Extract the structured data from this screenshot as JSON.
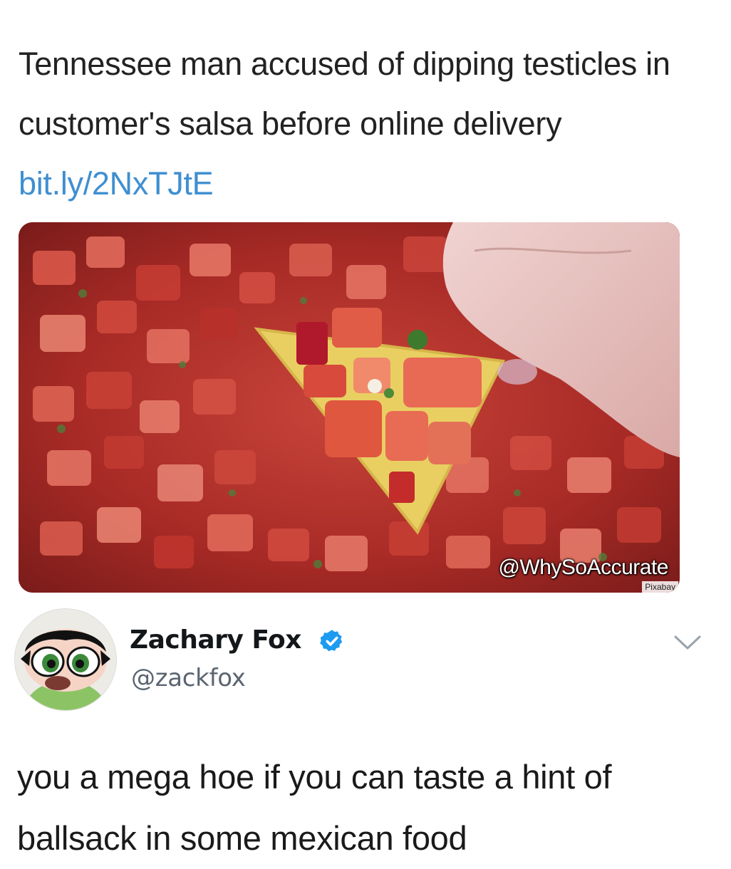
{
  "quoted_post": {
    "text": "Tennessee man accused of dipping testicles in customer's salsa before online delivery",
    "link": "bit.ly/2NxTJtE",
    "link_color": "#3f8fd1"
  },
  "media": {
    "watermark": "@WhySoAccurate",
    "credit": "Pixabay",
    "colors": {
      "salsa": "#b3322c",
      "chip": "#e9cf62",
      "finger": "#e7c2bf"
    }
  },
  "tweet": {
    "display_name": "Zachary Fox",
    "handle": "@zackfox",
    "verified_icon": "verified-badge-icon",
    "verified_color": "#1d9bf0",
    "more_icon": "chevron-down-icon",
    "text": "you a mega hoe if you can taste a hint of ballsack in some mexican food"
  }
}
